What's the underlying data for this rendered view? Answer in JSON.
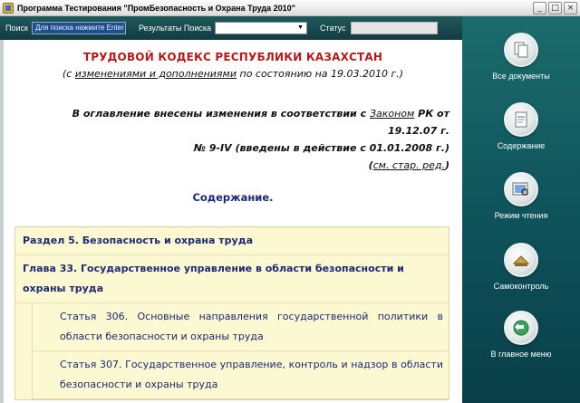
{
  "window": {
    "title": "Программа Тестирования \"ПромБезопасность и Охрана Труда 2010\"",
    "buttons": {
      "minimize": "_",
      "maximize": "□",
      "close": "×"
    }
  },
  "toolbar": {
    "search_label": "Поиск",
    "search_value": "Для поиска нажмите Enter",
    "results_label": "Результаты Поиска",
    "results_value": "",
    "status_label": "Статус"
  },
  "document": {
    "title": "ТРУДОВОЙ КОДЕКС РЕСПУБЛИКИ КАЗАХСТАН",
    "subtitle_prefix": "(с ",
    "subtitle_link": "изменениями и дополнениями",
    "subtitle_suffix": " по состоянию на 19.03.2010  г.)",
    "amend_line1_prefix": "В оглавление внесены изменения в соответствии с ",
    "amend_line1_link": "Законом",
    "amend_line1_suffix": " РК от",
    "amend_line2": "19.12.07 г.",
    "amend_line3": "№ 9-IV (введены в действие с 01.01.2008 г.)",
    "amend_line4_open": "(",
    "amend_line4_link": "см. стар. ред.",
    "amend_line4_close": ")",
    "toc_title": "Содержание.",
    "toc": [
      {
        "kind": "section",
        "text": "Раздел 5. Безопасность и охрана труда"
      },
      {
        "kind": "chapter",
        "text": "Глава 33. Государственное управление в области безопасности и охраны труда"
      },
      {
        "kind": "article",
        "text": "Статья 306. Основные направления государственной политики в области безопасности и охраны труда"
      },
      {
        "kind": "article",
        "text": "Статья 307. Государственное управление, контроль и надзор в области безопасности и охраны труда"
      }
    ]
  },
  "sidebar": {
    "items": [
      {
        "label": "Все документы",
        "icon": "documents-icon"
      },
      {
        "label": "Содержание",
        "icon": "contents-icon"
      },
      {
        "label": "Режим чтения",
        "icon": "reading-mode-icon"
      },
      {
        "label": "Самоконтроль",
        "icon": "self-test-icon"
      },
      {
        "label": "В главное меню",
        "icon": "back-arrow-icon"
      }
    ]
  }
}
